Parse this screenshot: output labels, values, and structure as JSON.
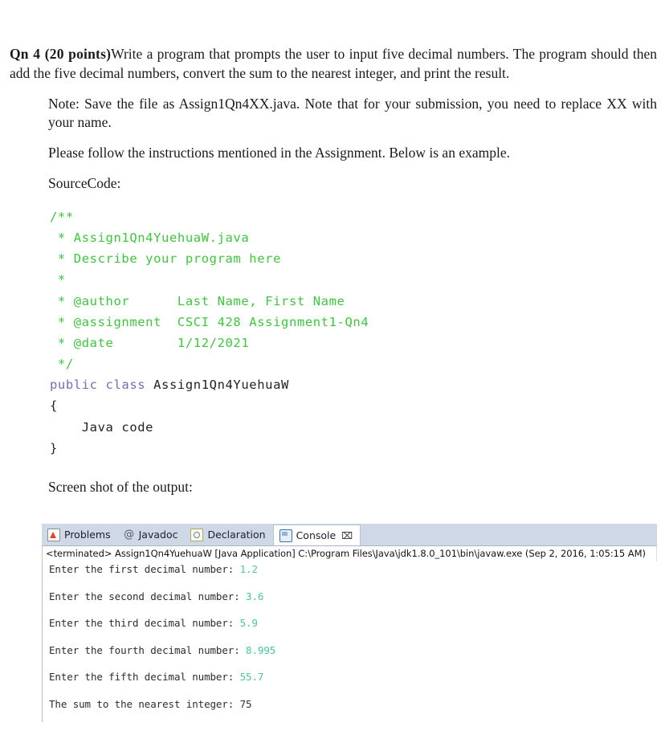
{
  "question": {
    "label": "Qn 4  (20 points)",
    "text": "Write a program that prompts the user to input five decimal numbers. The program should then add the five decimal numbers, convert the sum to the nearest integer, and print the result."
  },
  "note": "Note: Save the file as Assign1Qn4XX.java. Note that for your submission, you need to replace XX with your name.",
  "instructions": "Please follow the instructions mentioned in the Assignment. Below is an example.",
  "source_code_heading": "SourceCode:",
  "code": {
    "comment_open": "/**",
    "line_file": " * Assign1Qn4YuehuaW.java",
    "line_describe": " * Describe your program here",
    "line_blank": " *",
    "line_author": " * @author      Last Name, First Name",
    "line_assignment": " * @assignment  CSCI 428 Assignment1-Qn4",
    "line_date": " * @date        1/12/2021",
    "comment_close": " */",
    "keyword_public_class": "public class",
    "class_name": " Assign1Qn4YuehuaW",
    "brace_open": "{",
    "body": "    Java code",
    "brace_close": "}",
    "comment_color": "#3fc63f",
    "keyword_color": "#6f6fb8",
    "plain_color": "#232323"
  },
  "screenshot_heading": "Screen shot of the output:",
  "console": {
    "tabs": [
      {
        "label": "Problems",
        "icon": "problems-icon",
        "active": false
      },
      {
        "label": "Javadoc",
        "icon": "at-sign-icon",
        "active": false
      },
      {
        "label": "Declaration",
        "icon": "declaration-icon",
        "active": false
      },
      {
        "label": "Console",
        "icon": "monitor-icon",
        "active": true,
        "close_glyph": "⌧"
      }
    ],
    "status_line": "<terminated> Assign1Qn4YuehuaW [Java Application] C:\\Program Files\\Java\\jdk1.8.0_101\\bin\\javaw.exe (Sep 2, 2016, 1:05:15 AM)",
    "output": [
      {
        "prompt": "Enter the first decimal number: ",
        "value": "1.2",
        "value_color": "green"
      },
      {
        "prompt": "Enter the second decimal number: ",
        "value": "3.6",
        "value_color": "green"
      },
      {
        "prompt": "Enter the third decimal number: ",
        "value": "5.9",
        "value_color": "green"
      },
      {
        "prompt": "Enter the fourth decimal number: ",
        "value": "8.995",
        "value_color": "green"
      },
      {
        "prompt": "Enter the fifth decimal number: ",
        "value": "55.7",
        "value_color": "green"
      },
      {
        "prompt": "The sum to the nearest integer: ",
        "value": "75",
        "value_color": "dark"
      }
    ],
    "input_value_color": "#4ec59c",
    "tab_bar_color": "#cfd8e6",
    "active_tab_color": "#ffffff"
  }
}
